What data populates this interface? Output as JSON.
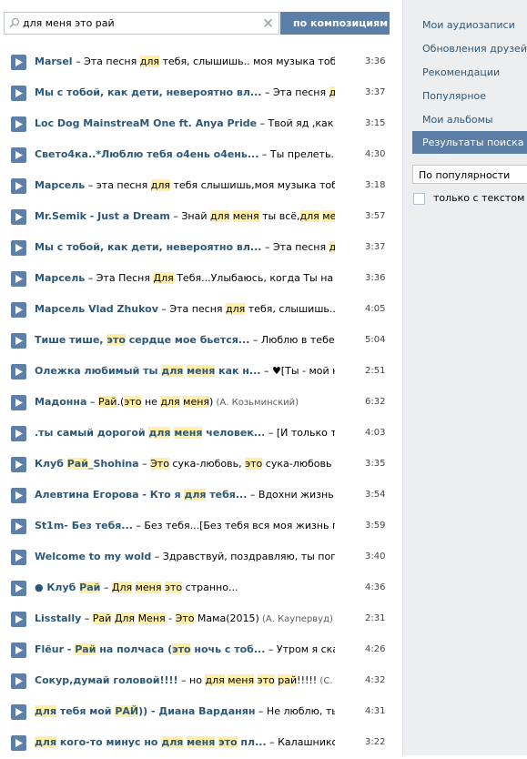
{
  "search": {
    "query": "для меня это рай",
    "clear_icon": "×",
    "mode_label": "по композициям",
    "mode_caret": "▼"
  },
  "colors": {
    "accent": "#5b7fa6",
    "artist_link": "#2b587a",
    "highlight": "#ffefa8",
    "sidebar_bg": "#edeef0"
  },
  "tracks": [
    {
      "artist": [
        {
          "t": "Marsel",
          "h": false
        }
      ],
      "title": [
        {
          "t": " – Эта песня ",
          "h": false
        },
        {
          "t": "для",
          "h": true
        },
        {
          "t": " тебя, слышишь.. моя музыка тобой ды...",
          "h": false
        }
      ],
      "duration": "3:36"
    },
    {
      "artist": [
        {
          "t": "Мы с тобой, как дети, невероятно вл...",
          "h": false
        }
      ],
      "title": [
        {
          "t": " – Эта песня ",
          "h": false
        },
        {
          "t": "для",
          "h": true
        },
        {
          "t": " ",
          "h": false
        }
      ],
      "duration": "3:37"
    },
    {
      "artist": [
        {
          "t": "Loc Dog MainstreaM One ft. Anya Pride",
          "h": false
        }
      ],
      "title": [
        {
          "t": " – Твой яд ,как нежн...",
          "h": false
        }
      ],
      "duration": "3:15"
    },
    {
      "artist": [
        {
          "t": "Свето4ка..*Люблю тебя о4ень о4ень...",
          "h": false
        }
      ],
      "title": [
        {
          "t": " – Ты прелеть..*С...",
          "h": false
        }
      ],
      "duration": "4:30"
    },
    {
      "artist": [
        {
          "t": "Марсель",
          "h": false
        }
      ],
      "title": [
        {
          "t": " – эта песня ",
          "h": false
        },
        {
          "t": "для",
          "h": true
        },
        {
          "t": " тебя слышишь,моя музыка тобой ды...",
          "h": false
        }
      ],
      "duration": "3:18"
    },
    {
      "artist": [
        {
          "t": "Mr.Semik - Just a Dream",
          "h": false
        }
      ],
      "title": [
        {
          "t": " – Знай ",
          "h": false
        },
        {
          "t": "для",
          "h": true
        },
        {
          "t": " ",
          "h": false
        },
        {
          "t": "меня",
          "h": true
        },
        {
          "t": " ты всё,",
          "h": false
        },
        {
          "t": "для",
          "h": true
        },
        {
          "t": " ",
          "h": false
        },
        {
          "t": "меня",
          "h": true
        },
        {
          "t": " т... ",
          "h": false
        }
      ],
      "duration": "3:57"
    },
    {
      "artist": [
        {
          "t": "Мы с тобой, как дети, невероятно вл...",
          "h": false
        }
      ],
      "title": [
        {
          "t": " – Эта песня ",
          "h": false
        },
        {
          "t": "для",
          "h": true
        },
        {
          "t": " ",
          "h": false
        }
      ],
      "duration": "3:37"
    },
    {
      "artist": [
        {
          "t": "Марсель",
          "h": false
        }
      ],
      "title": [
        {
          "t": " – Эта Песня ",
          "h": false
        },
        {
          "t": "Для",
          "h": true
        },
        {
          "t": " Тебя...Улыбаюсь, когда Ты на встре...",
          "h": false
        }
      ],
      "duration": "3:36"
    },
    {
      "artist": [
        {
          "t": "Марсель Vlad Zhukov",
          "h": false
        }
      ],
      "title": [
        {
          "t": " – Эта песня ",
          "h": false
        },
        {
          "t": "для",
          "h": true
        },
        {
          "t": " тебя, слышишь.. моя ...",
          "h": false
        }
      ],
      "duration": "4:05"
    },
    {
      "artist": [
        {
          "t": "Тише тише, ",
          "h": false
        },
        {
          "t": "это",
          "h": true
        },
        {
          "t": " сердце мое бьется...",
          "h": false
        }
      ],
      "title": [
        {
          "t": " – Люблю в тебе все: ...",
          "h": false
        }
      ],
      "duration": "5:04"
    },
    {
      "artist": [
        {
          "t": "Олежка любимый ты ",
          "h": false
        },
        {
          "t": "для",
          "h": true
        },
        {
          "t": " ",
          "h": false
        },
        {
          "t": "меня",
          "h": true
        },
        {
          "t": " как н...",
          "h": false
        }
      ],
      "title": [
        {
          "t": " – ♥[Ты - мой нар...",
          "h": false
        }
      ],
      "duration": "2:51"
    },
    {
      "artist": [
        {
          "t": "Мадонна",
          "h": false
        }
      ],
      "title": [
        {
          "t": " – ",
          "h": false
        },
        {
          "t": "Рай",
          "h": true
        },
        {
          "t": ".(",
          "h": false
        },
        {
          "t": "это",
          "h": true
        },
        {
          "t": " не ",
          "h": false
        },
        {
          "t": "для",
          "h": true
        },
        {
          "t": " ",
          "h": false
        },
        {
          "t": "меня",
          "h": true
        },
        {
          "t": ")",
          "h": false
        }
      ],
      "sub": " (А. Козьминский)",
      "duration": "6:32"
    },
    {
      "artist": [
        {
          "t": ".ты самый дорогой ",
          "h": false
        },
        {
          "t": "для",
          "h": true
        },
        {
          "t": " ",
          "h": false
        },
        {
          "t": "меня",
          "h": true
        },
        {
          "t": " человек...",
          "h": false
        }
      ],
      "title": [
        {
          "t": " – [И только ты и ...",
          "h": false
        }
      ],
      "duration": "4:03"
    },
    {
      "artist": [
        {
          "t": "Клуб ",
          "h": false
        },
        {
          "t": "Рай",
          "h": true
        },
        {
          "t": "_Shohina",
          "h": false
        }
      ],
      "title": [
        {
          "t": " – ",
          "h": false
        },
        {
          "t": "Это",
          "h": true
        },
        {
          "t": " сука-любовь, ",
          "h": false
        },
        {
          "t": "это",
          "h": true
        },
        {
          "t": " сука-любовь ",
          "h": false
        },
        {
          "t": "Это",
          "h": true
        },
        {
          "t": " с...",
          "h": false
        }
      ],
      "duration": "3:35"
    },
    {
      "artist": [
        {
          "t": "Алевтина Егорова - Кто я ",
          "h": false
        },
        {
          "t": "для",
          "h": true
        },
        {
          "t": " тебя...",
          "h": false
        }
      ],
      "title": [
        {
          "t": " – Вдохни жизнь в ",
          "h": false
        },
        {
          "t": "ме...",
          "h": true
        }
      ],
      "duration": "3:54"
    },
    {
      "artist": [
        {
          "t": "St1m- Без тебя...",
          "h": false
        }
      ],
      "title": [
        {
          "t": " – Без тебя...[Без тебя вся моя жизнь под от...",
          "h": false
        }
      ],
      "duration": "3:59"
    },
    {
      "artist": [
        {
          "t": "Welcome to my wold",
          "h": false
        }
      ],
      "title": [
        {
          "t": " – Здравствуй, поздравляю, ты попал в ...",
          "h": false
        }
      ],
      "duration": "3:40"
    },
    {
      "artist": [
        {
          "t": "● Клуб ",
          "h": false
        },
        {
          "t": "Рай",
          "h": true
        }
      ],
      "title": [
        {
          "t": " – ",
          "h": false
        },
        {
          "t": "Для",
          "h": true
        },
        {
          "t": " ",
          "h": false
        },
        {
          "t": "меня",
          "h": true
        },
        {
          "t": " ",
          "h": false
        },
        {
          "t": "это",
          "h": true
        },
        {
          "t": " странно...",
          "h": false
        }
      ],
      "duration": "4:36"
    },
    {
      "artist": [
        {
          "t": "Lisstally",
          "h": false
        }
      ],
      "title": [
        {
          "t": " – ",
          "h": false
        },
        {
          "t": "Рай",
          "h": true
        },
        {
          "t": " ",
          "h": false
        },
        {
          "t": "Для",
          "h": true
        },
        {
          "t": " ",
          "h": false
        },
        {
          "t": "Меня",
          "h": true
        },
        {
          "t": " - ",
          "h": false
        },
        {
          "t": "Это",
          "h": true
        },
        {
          "t": " Мама(2015)",
          "h": false
        }
      ],
      "sub": " (А. Каупервуд)",
      "duration": "2:31"
    },
    {
      "artist": [
        {
          "t": "Flëur - ",
          "h": false
        },
        {
          "t": "Рай",
          "h": true
        },
        {
          "t": " на полчаса (",
          "h": false
        },
        {
          "t": "это",
          "h": true
        },
        {
          "t": " ночь с тоб...",
          "h": false
        }
      ],
      "title": [
        {
          "t": " – Утром я сказал...",
          "h": false
        }
      ],
      "duration": "4:26"
    },
    {
      "artist": [
        {
          "t": "Сокур,думай головой!!!!",
          "h": false
        }
      ],
      "title": [
        {
          "t": " – но ",
          "h": false
        },
        {
          "t": "для",
          "h": true
        },
        {
          "t": " ",
          "h": false
        },
        {
          "t": "меня",
          "h": true
        },
        {
          "t": " ",
          "h": false
        },
        {
          "t": "это",
          "h": true
        },
        {
          "t": " ",
          "h": false
        },
        {
          "t": "рай",
          "h": true
        },
        {
          "t": "!!!!!",
          "h": false
        }
      ],
      "sub": " (С. Лобода)",
      "duration": "4:32"
    },
    {
      "artist": [
        {
          "t": "для",
          "h": true
        },
        {
          "t": " тебя мой ",
          "h": false
        },
        {
          "t": "РАЙ",
          "h": true
        },
        {
          "t": ")) - Диана Варданян",
          "h": false
        }
      ],
      "title": [
        {
          "t": " – Не люблю, ты ",
          "h": false
        },
        {
          "t": "это...",
          "h": true
        }
      ],
      "duration": "4:31"
    },
    {
      "artist": [
        {
          "t": "для",
          "h": true
        },
        {
          "t": " кого-то минус но ",
          "h": false
        },
        {
          "t": "для",
          "h": true
        },
        {
          "t": " ",
          "h": false
        },
        {
          "t": "меня",
          "h": true
        },
        {
          "t": " ",
          "h": false
        },
        {
          "t": "это",
          "h": true
        },
        {
          "t": " пл...",
          "h": false
        }
      ],
      "title": [
        {
          "t": " – Калашников ст...",
          "h": false
        }
      ],
      "duration": "3:22"
    }
  ],
  "sidebar": {
    "items": [
      "Мои аудиозаписи",
      "Обновления друзей",
      "Рекомендации",
      "Популярное",
      "Мои альбомы"
    ],
    "active_item": "Результаты поиска",
    "sort_value": "По популярности",
    "lyrics_only_label": "только с текстом"
  },
  "icons": {
    "play": "play-icon",
    "search": "search-icon",
    "clear": "clear-icon",
    "caret": "chevron-down-icon",
    "checkbox": "checkbox-icon"
  }
}
